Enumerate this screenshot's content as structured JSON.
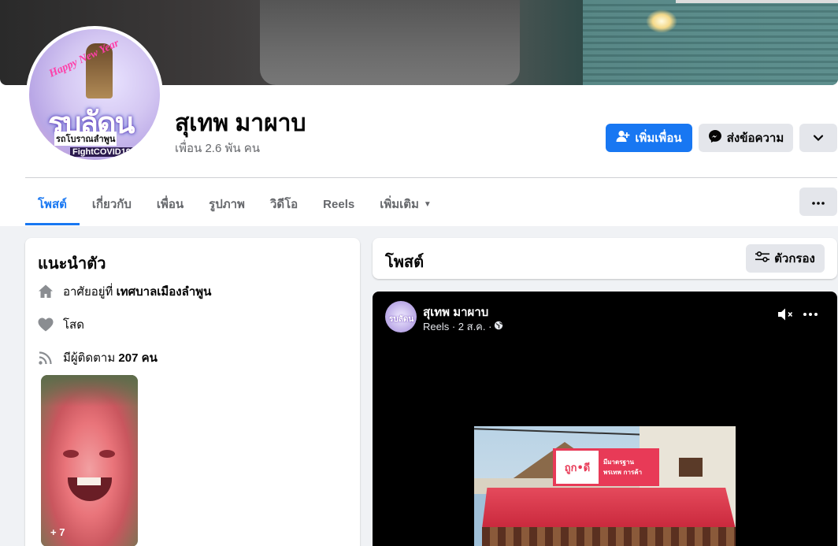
{
  "profile": {
    "name": "สุเทพ มาผาบ",
    "friends": "เพื่อน 2.6 พัน คน",
    "avatar_text": {
      "banner": "Happy New Year",
      "big": "รบลัดน",
      "sub": "รถโบราณลำพูน",
      "badge": "FightCOVID19"
    }
  },
  "actions": {
    "add_friend": "เพิ่มเพื่อน",
    "message": "ส่งข้อความ"
  },
  "tabs": [
    {
      "label": "โพสต์",
      "active": true
    },
    {
      "label": "เกี่ยวกับ"
    },
    {
      "label": "เพื่อน"
    },
    {
      "label": "รูปภาพ"
    },
    {
      "label": "วิดีโอ"
    },
    {
      "label": "Reels"
    },
    {
      "label": "เพิ่มเติม"
    }
  ],
  "intro": {
    "title": "แนะนำตัว",
    "lives_prefix": "อาศัยอยู่ที่ ",
    "lives_place": "เทศบาลเมืองลำพูน",
    "relationship": "โสด",
    "followers_prefix": "มีผู้ติดตาม ",
    "followers_count": "207 คน",
    "photo_more": "+ 7"
  },
  "posts": {
    "title": "โพสต์",
    "filter": "ตัวกรอง"
  },
  "reel_post": {
    "author": "สุเทพ มาผาบ",
    "meta": "Reels · 2 ส.ค. ·",
    "avatar_text": "รบลัดน",
    "sign_logo": "ถูก•ดี",
    "sign_sub": "มีมาตรฐาน",
    "sign_text": "พรเทพ การค้า"
  },
  "colors": {
    "primary": "#1877f2",
    "secondary_button": "#e4e6eb",
    "background": "#f0f2f5",
    "muted_text": "#65676b"
  },
  "icons": {
    "add_friend": "person-plus-icon",
    "message": "messenger-icon",
    "more": "chevron-down-icon",
    "home": "home-icon",
    "heart": "heart-icon",
    "followers": "rss-icon",
    "filter": "sliders-icon",
    "mute": "speaker-muted-icon",
    "globe": "globe-icon"
  }
}
